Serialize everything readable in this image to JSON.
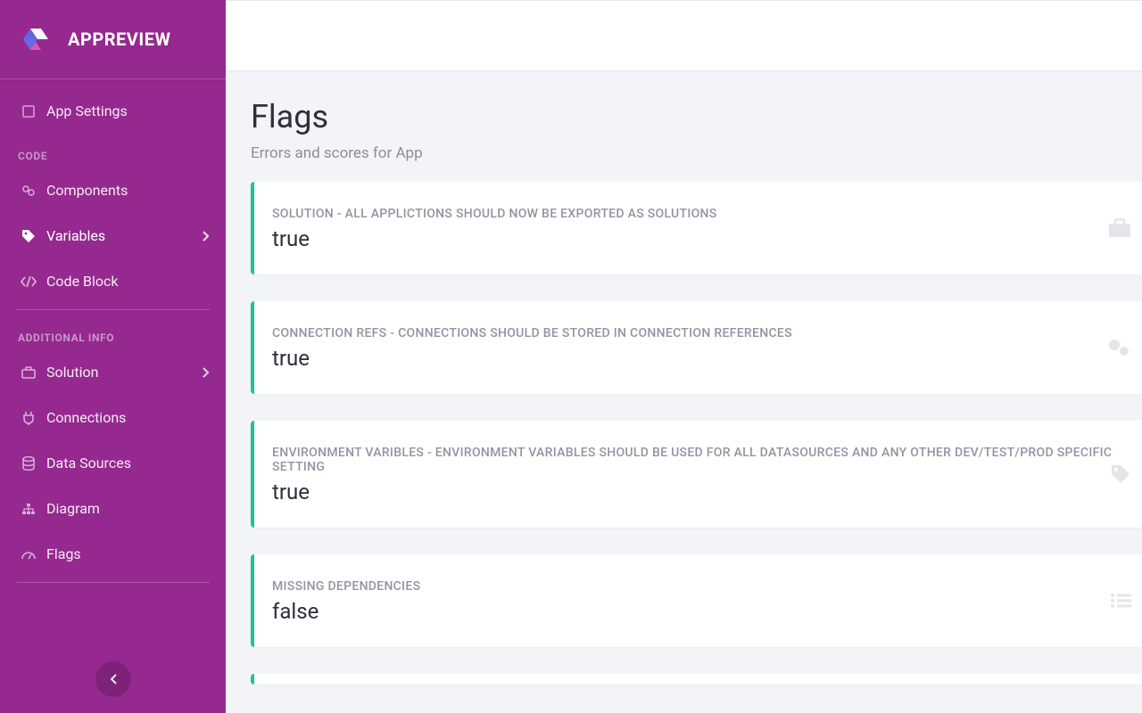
{
  "brand": {
    "title": "APPREVIEW"
  },
  "sidebar": {
    "app_settings": "App Settings",
    "section_code": "CODE",
    "components": "Components",
    "variables": "Variables",
    "code_block": "Code Block",
    "section_additional": "ADDITIONAL INFO",
    "solution": "Solution",
    "connections": "Connections",
    "data_sources": "Data Sources",
    "diagram": "Diagram",
    "flags": "Flags"
  },
  "page": {
    "title": "Flags",
    "subtitle": "Errors and scores for App"
  },
  "cards": [
    {
      "label": "SOLUTION - ALL APPLICTIONS SHOULD NOW BE EXPORTED AS SOLUTIONS",
      "value": "true"
    },
    {
      "label": "CONNECTION REFS - CONNECTIONS SHOULD BE STORED IN CONNECTION REFERENCES",
      "value": "true"
    },
    {
      "label": "ENVIRONMENT VARIBLES - ENVIRONMENT VARIABLES SHOULD BE USED FOR ALL DATASOURCES AND ANY OTHER DEV/TEST/PROD SPECIFIC SETTING",
      "value": "true"
    },
    {
      "label": "MISSING DEPENDENCIES",
      "value": "false"
    }
  ]
}
